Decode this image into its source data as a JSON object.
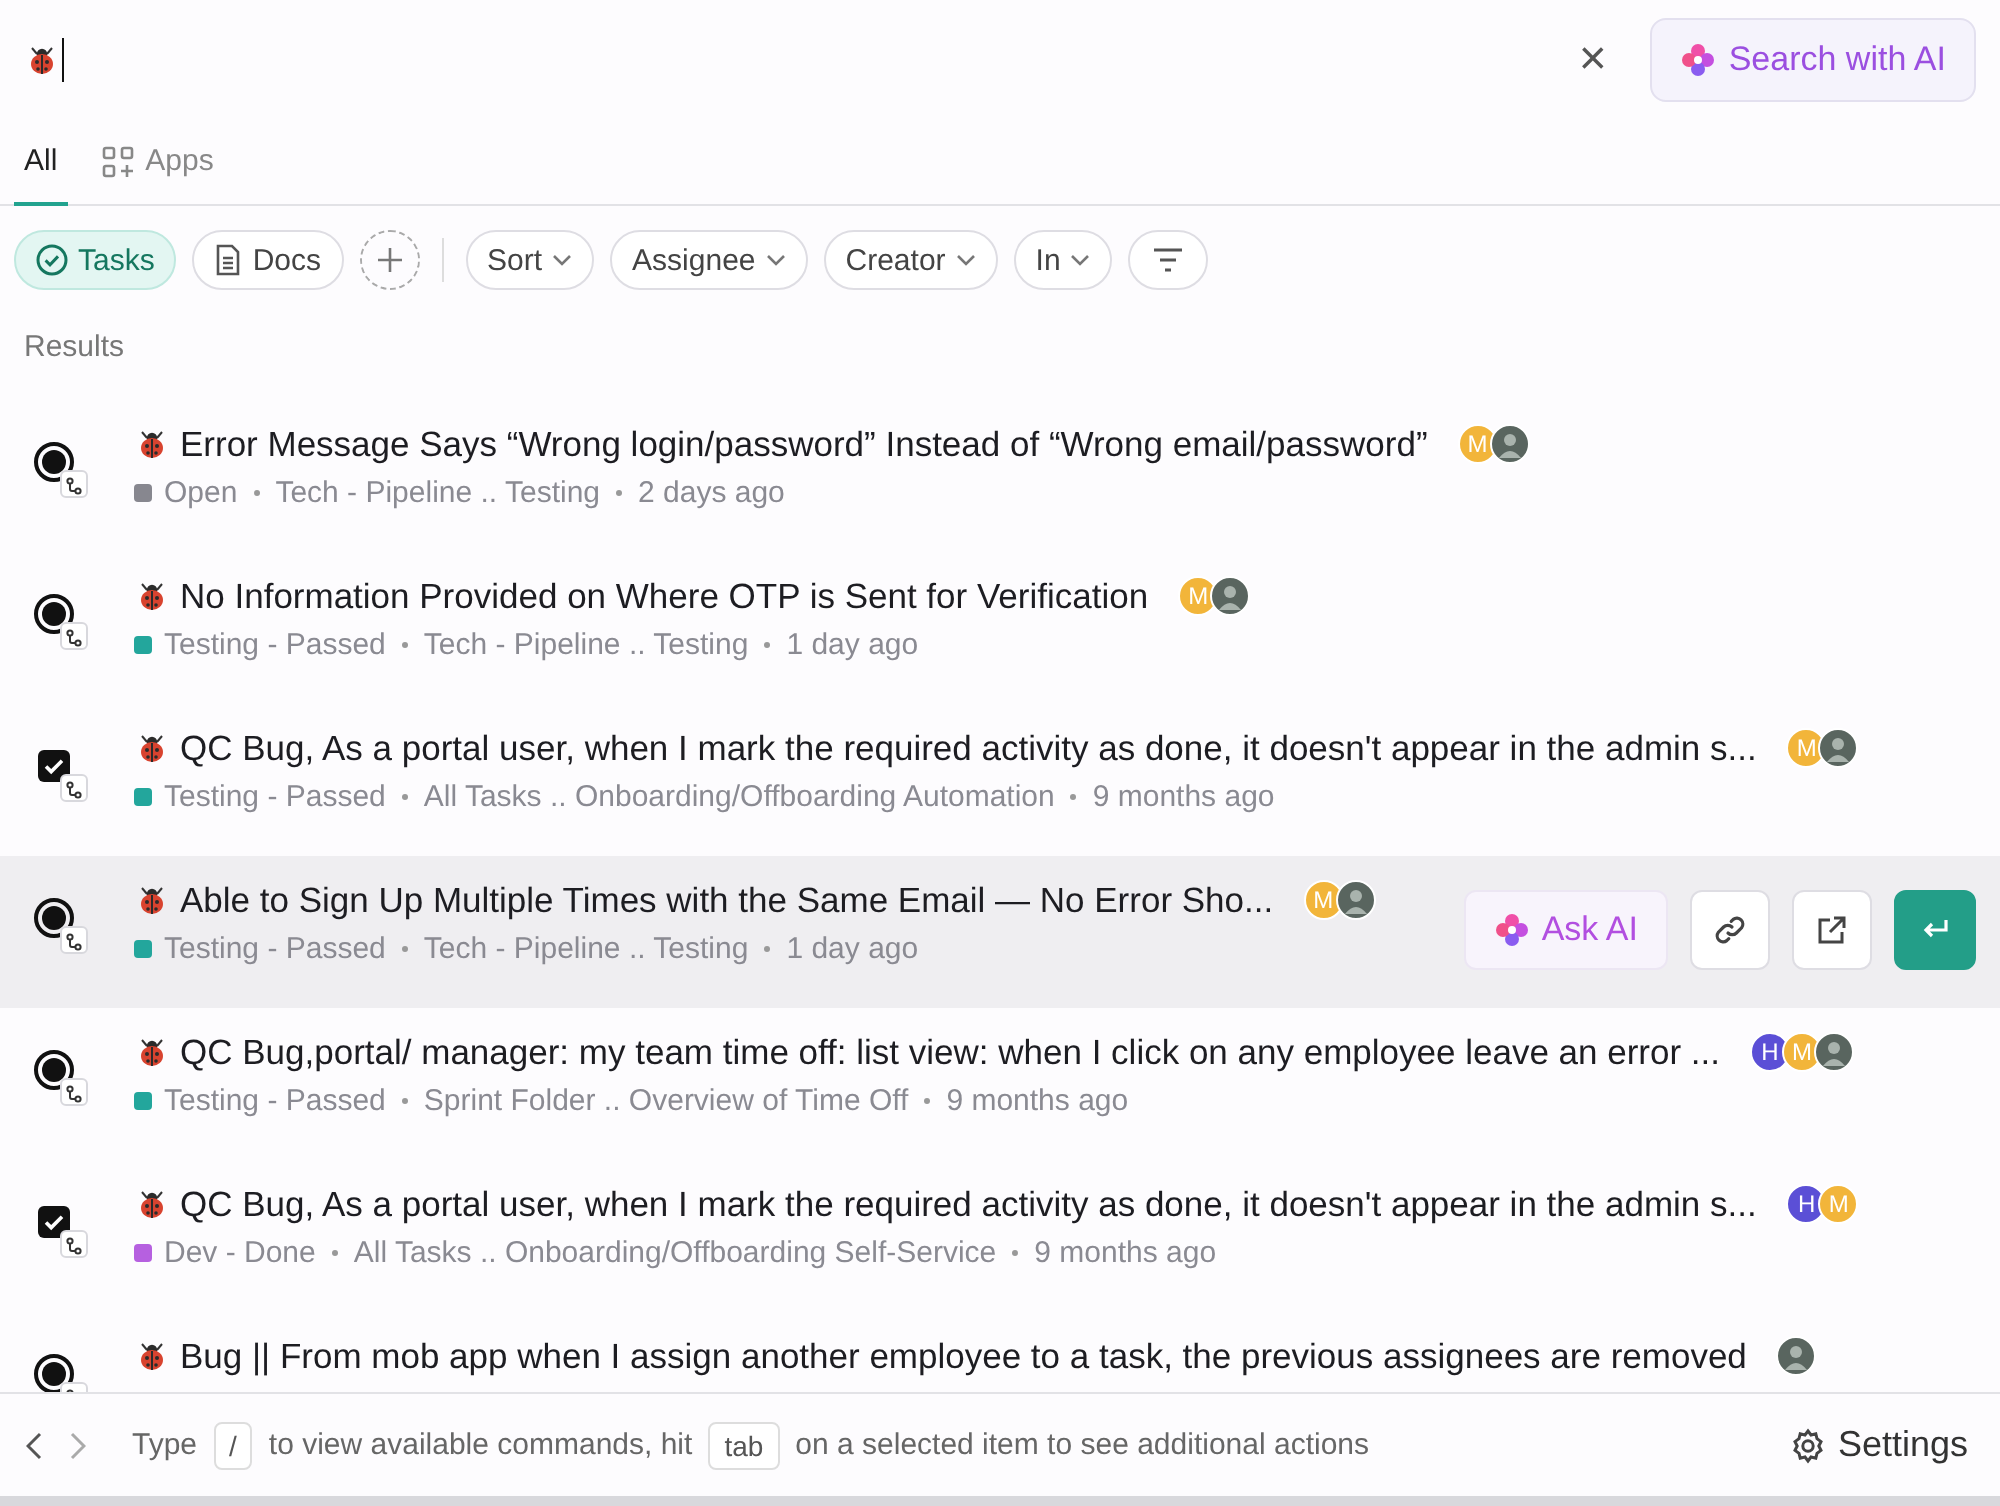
{
  "search": {
    "clear": "×",
    "ai_button": "Search with AI"
  },
  "tabs": [
    {
      "label": "All",
      "selected": true,
      "kind": "plain"
    },
    {
      "label": "Apps",
      "selected": false,
      "kind": "apps"
    }
  ],
  "filters": [
    {
      "label": "Tasks",
      "kind": "tasks",
      "selected": true
    },
    {
      "label": "Docs",
      "kind": "docs",
      "selected": false
    },
    {
      "kind": "add"
    },
    {
      "kind": "divider"
    },
    {
      "label": "Sort",
      "kind": "dropdown"
    },
    {
      "label": "Assignee",
      "kind": "dropdown"
    },
    {
      "label": "Creator",
      "kind": "dropdown"
    },
    {
      "label": "In",
      "kind": "dropdown"
    },
    {
      "kind": "lines"
    }
  ],
  "results_label": "Results",
  "results": [
    {
      "kind": "milestone",
      "title": "Error Message Says “Wrong login/password” Instead of “Wrong email/password”",
      "status": "Open",
      "color": "#87878f",
      "path": "Tech - Pipeline .. Testing",
      "time": "2 days ago",
      "selected": false,
      "assignees": [
        {
          "kind": "letter",
          "letter": "M",
          "color": "#f2b53a"
        },
        {
          "kind": "photo"
        }
      ]
    },
    {
      "kind": "milestone",
      "title": "No Information Provided on Where OTP is Sent for Verification",
      "status": "Testing - Passed",
      "color": "#23a69c",
      "path": "Tech - Pipeline .. Testing",
      "time": "1 day ago",
      "selected": false,
      "assignees": [
        {
          "kind": "letter",
          "letter": "M",
          "color": "#f2b53a"
        },
        {
          "kind": "photo"
        }
      ]
    },
    {
      "kind": "checked",
      "title": "QC Bug, As a portal user, when I mark the required activity as done, it doesn't appear in the admin s...",
      "status": "Testing - Passed",
      "color": "#23a69c",
      "path": "All Tasks .. Onboarding/Offboarding Automation",
      "time": "9 months ago",
      "selected": false,
      "assignees": [
        {
          "kind": "letter",
          "letter": "M",
          "color": "#f2b53a"
        },
        {
          "kind": "photo"
        }
      ]
    },
    {
      "kind": "milestone",
      "title": "Able to Sign Up Multiple Times with the Same Email — No Error Sho...",
      "status": "Testing - Passed",
      "color": "#23a69c",
      "path": "Tech - Pipeline .. Testing",
      "time": "1 day ago",
      "selected": true,
      "assignees": [
        {
          "kind": "letter",
          "letter": "M",
          "color": "#f2b53a"
        },
        {
          "kind": "photo"
        }
      ],
      "actions": {
        "ask_ai": "Ask AI"
      }
    },
    {
      "kind": "milestone",
      "title": "QC Bug,portal/ manager: my team time off: list view: when I click on any employee leave an error ...",
      "status": "Testing - Passed",
      "color": "#23a69c",
      "path": "Sprint Folder .. Overview of Time Off",
      "time": "9 months ago",
      "selected": false,
      "assignees": [
        {
          "kind": "letter",
          "letter": "H",
          "color": "#5b4fd6"
        },
        {
          "kind": "letter",
          "letter": "M",
          "color": "#f2b53a"
        },
        {
          "kind": "photo"
        }
      ]
    },
    {
      "kind": "checked",
      "title": "QC Bug, As a portal user, when I mark the required activity as done, it doesn't appear in the admin s...",
      "status": "Dev - Done",
      "color": "#b660e0",
      "path": "All Tasks .. Onboarding/Offboarding Self-Service",
      "time": "9 months ago",
      "selected": false,
      "assignees": [
        {
          "kind": "letter",
          "letter": "H",
          "color": "#5b4fd6"
        },
        {
          "kind": "letter",
          "letter": "M",
          "color": "#f2b53a"
        }
      ]
    },
    {
      "kind": "milestone",
      "title": "Bug || From mob app when I assign another employee to a task, the previous assignees are removed",
      "selected": false,
      "assignees": [
        {
          "kind": "photo"
        }
      ]
    }
  ],
  "footer": {
    "type": "Type",
    "key1": "/",
    "mid": "to view available commands, hit",
    "key2": "tab",
    "end": "on a selected item to see additional actions",
    "settings": "Settings"
  }
}
